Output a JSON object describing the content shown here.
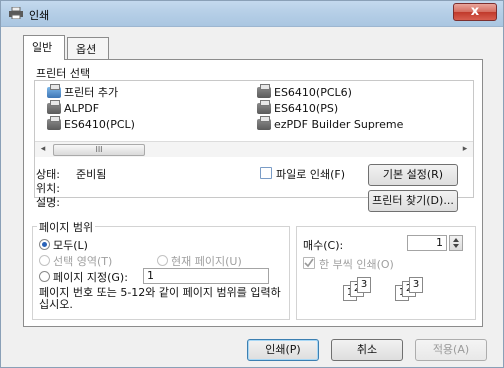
{
  "window": {
    "title": "인쇄",
    "close_glyph": "x"
  },
  "tabs": [
    {
      "label": "일반"
    },
    {
      "label": "옵션"
    }
  ],
  "printer_select": {
    "label": "프린터 선택",
    "printers": [
      {
        "name": "프린터 추가",
        "icon": "add-printer-icon"
      },
      {
        "name": "ALPDF",
        "icon": "printer-icon"
      },
      {
        "name": "ES6410(PCL)",
        "icon": "printer-icon"
      },
      {
        "name": "ES6410(PCL6)",
        "icon": "printer-icon"
      },
      {
        "name": "ES6410(PS)",
        "icon": "printer-icon"
      },
      {
        "name": "ezPDF Builder Supreme",
        "icon": "printer-icon"
      }
    ],
    "scroll_left": "◂",
    "scroll_right": "▸",
    "scroll_thumb_grip": "III"
  },
  "status": {
    "state_label": "상태:",
    "state_value": "준비됨",
    "location_label": "위치:",
    "comment_label": "설명:",
    "print_to_file_label": "파일로 인쇄(F)",
    "print_to_file_checked": false,
    "preferences_button": "기본 설정(R)",
    "find_printer_button": "프린터 찾기(D)..."
  },
  "page_range": {
    "label": "페이지 범위",
    "all": "모두(L)",
    "selection": "선택 영역(T)",
    "current_page": "현재 페이지(U)",
    "pages": "페이지 지정(G):",
    "pages_value": "1",
    "hint": "페이지 번호 또는 5-12와 같이 페이지 범위를 입력하십시오.",
    "selected": "all"
  },
  "copies": {
    "label": "매수(C):",
    "value": "1",
    "collate_label": "한 부씩 인쇄(O)",
    "collate_checked": true,
    "sheet_numbers": [
      "1",
      "2",
      "3"
    ]
  },
  "footer": {
    "print_button": "인쇄(P)",
    "cancel_button": "취소",
    "apply_button": "적용(A)"
  }
}
